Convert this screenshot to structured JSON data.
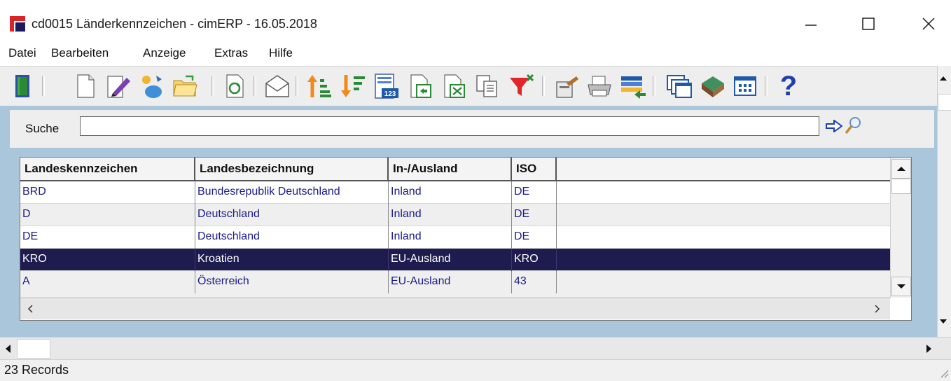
{
  "window": {
    "title": "cd0015 Länderkennzeichen - cimERP - 16.05.2018",
    "controls": [
      "minimize-icon",
      "maximize-icon",
      "close-icon"
    ]
  },
  "menu": [
    "Datei",
    "Bearbeiten",
    "Anzeige",
    "Extras",
    "Hilfe"
  ],
  "toolbar": {
    "buttons": [
      "exit-icon",
      "new-document-icon",
      "edit-icon",
      "copy-record-icon",
      "open-folder-icon",
      "refresh-icon",
      "mail-icon",
      "sort-ascending-icon",
      "sort-descending-icon",
      "table-123-icon",
      "export-icon",
      "excel-export-icon",
      "copy-pages-icon",
      "filter-icon",
      "properties-icon",
      "print-icon",
      "import-icon",
      "windows-icon",
      "book-icon",
      "grid-view-icon",
      "help-icon"
    ],
    "help_glyph": "?"
  },
  "search": {
    "label": "Suche",
    "value": "",
    "go_icon": "arrow-right-icon",
    "find_icon": "magnifier-icon"
  },
  "grid": {
    "columns": [
      "Landeskennzeichen",
      "Landesbezeichnung",
      "In-/Ausland",
      "ISO",
      ""
    ],
    "rows": [
      {
        "code": "BRD",
        "name": "Bundesrepublik Deutschland",
        "region": "Inland",
        "iso": "DE"
      },
      {
        "code": "D",
        "name": "Deutschland",
        "region": "Inland",
        "iso": "DE"
      },
      {
        "code": "DE",
        "name": "Deutschland",
        "region": "Inland",
        "iso": "DE"
      },
      {
        "code": "KRO",
        "name": "Kroatien",
        "region": "EU-Ausland",
        "iso": "KRO"
      },
      {
        "code": "A",
        "name": "Österreich",
        "region": "EU-Ausland",
        "iso": "43"
      }
    ],
    "selected_row": 3
  },
  "colors": {
    "selection": "#1e1b4e",
    "cell_text": "#1b1b8a",
    "work_area": "#a9c6da",
    "toolbar": "#eeeeee"
  },
  "status": {
    "records": "23 Records"
  }
}
